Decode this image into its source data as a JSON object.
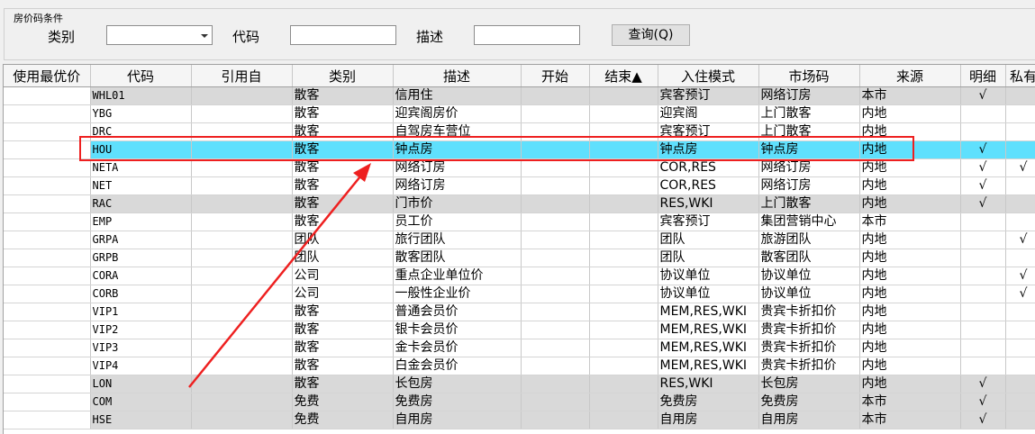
{
  "filter": {
    "title": "房价码条件",
    "category_label": "类别",
    "category_value": "",
    "code_label": "代码",
    "code_value": "",
    "desc_label": "描述",
    "desc_value": "",
    "query_button": "查询(Q)"
  },
  "table": {
    "columns": [
      "使用最优价",
      "代码",
      "引用自",
      "类别",
      "描述",
      "开始",
      "结束▲",
      "入住模式",
      "市场码",
      "来源",
      "明细",
      "私有"
    ],
    "rows": [
      {
        "best": "",
        "code": "WHL01",
        "ref": "",
        "cat": "散客",
        "desc": "信用住",
        "start": "",
        "end": "",
        "mode": "宾客预订",
        "market": "网络订房",
        "source": "本市",
        "detail": "√",
        "private": "",
        "style": "gray"
      },
      {
        "best": "",
        "code": "YBG",
        "ref": "",
        "cat": "散客",
        "desc": "迎宾阁房价",
        "start": "",
        "end": "",
        "mode": "迎宾阁",
        "market": "上门散客",
        "source": "内地",
        "detail": "",
        "private": "",
        "style": ""
      },
      {
        "best": "",
        "code": "DRC",
        "ref": "",
        "cat": "散客",
        "desc": "自驾房车营位",
        "start": "",
        "end": "",
        "mode": "宾客预订",
        "market": "上门散客",
        "source": "内地",
        "detail": "",
        "private": "",
        "style": ""
      },
      {
        "best": "",
        "code": "HOU",
        "ref": "",
        "cat": "散客",
        "desc": "钟点房",
        "start": "",
        "end": "",
        "mode": "钟点房",
        "market": "钟点房",
        "source": "内地",
        "detail": "√",
        "private": "",
        "style": "sel"
      },
      {
        "best": "",
        "code": "NETA",
        "ref": "",
        "cat": "散客",
        "desc": "网络订房",
        "start": "",
        "end": "",
        "mode": "COR,RES",
        "market": "网络订房",
        "source": "内地",
        "detail": "√",
        "private": "√",
        "style": ""
      },
      {
        "best": "",
        "code": "NET",
        "ref": "",
        "cat": "散客",
        "desc": "网络订房",
        "start": "",
        "end": "",
        "mode": "COR,RES",
        "market": "网络订房",
        "source": "内地",
        "detail": "√",
        "private": "",
        "style": ""
      },
      {
        "best": "",
        "code": "RAC",
        "ref": "",
        "cat": "散客",
        "desc": "门市价",
        "start": "",
        "end": "",
        "mode": "RES,WKI",
        "market": "上门散客",
        "source": "内地",
        "detail": "√",
        "private": "",
        "style": "gray"
      },
      {
        "best": "",
        "code": "EMP",
        "ref": "",
        "cat": "散客",
        "desc": "员工价",
        "start": "",
        "end": "",
        "mode": "宾客预订",
        "market": "集团营销中心",
        "source": "本市",
        "detail": "",
        "private": "",
        "style": ""
      },
      {
        "best": "",
        "code": "GRPA",
        "ref": "",
        "cat": "团队",
        "desc": "旅行团队",
        "start": "",
        "end": "",
        "mode": "团队",
        "market": "旅游团队",
        "source": "内地",
        "detail": "",
        "private": "√",
        "style": ""
      },
      {
        "best": "",
        "code": "GRPB",
        "ref": "",
        "cat": "团队",
        "desc": "散客团队",
        "start": "",
        "end": "",
        "mode": "团队",
        "market": "散客团队",
        "source": "内地",
        "detail": "",
        "private": "",
        "style": ""
      },
      {
        "best": "",
        "code": "CORA",
        "ref": "",
        "cat": "公司",
        "desc": "重点企业单位价",
        "start": "",
        "end": "",
        "mode": "协议单位",
        "market": "协议单位",
        "source": "内地",
        "detail": "",
        "private": "√",
        "style": ""
      },
      {
        "best": "",
        "code": "CORB",
        "ref": "",
        "cat": "公司",
        "desc": "一般性企业价",
        "start": "",
        "end": "",
        "mode": "协议单位",
        "market": "协议单位",
        "source": "内地",
        "detail": "",
        "private": "√",
        "style": ""
      },
      {
        "best": "",
        "code": "VIP1",
        "ref": "",
        "cat": "散客",
        "desc": "普通会员价",
        "start": "",
        "end": "",
        "mode": "MEM,RES,WKI",
        "market": "贵宾卡折扣价",
        "source": "内地",
        "detail": "",
        "private": "",
        "style": ""
      },
      {
        "best": "",
        "code": "VIP2",
        "ref": "",
        "cat": "散客",
        "desc": "银卡会员价",
        "start": "",
        "end": "",
        "mode": "MEM,RES,WKI",
        "market": "贵宾卡折扣价",
        "source": "内地",
        "detail": "",
        "private": "",
        "style": ""
      },
      {
        "best": "",
        "code": "VIP3",
        "ref": "",
        "cat": "散客",
        "desc": "金卡会员价",
        "start": "",
        "end": "",
        "mode": "MEM,RES,WKI",
        "market": "贵宾卡折扣价",
        "source": "内地",
        "detail": "",
        "private": "",
        "style": ""
      },
      {
        "best": "",
        "code": "VIP4",
        "ref": "",
        "cat": "散客",
        "desc": "白金会员价",
        "start": "",
        "end": "",
        "mode": "MEM,RES,WKI",
        "market": "贵宾卡折扣价",
        "source": "内地",
        "detail": "",
        "private": "",
        "style": ""
      },
      {
        "best": "",
        "code": "LON",
        "ref": "",
        "cat": "散客",
        "desc": "长包房",
        "start": "",
        "end": "",
        "mode": "RES,WKI",
        "market": "长包房",
        "source": "内地",
        "detail": "√",
        "private": "",
        "style": "gray"
      },
      {
        "best": "",
        "code": "COM",
        "ref": "",
        "cat": "免费",
        "desc": "免费房",
        "start": "",
        "end": "",
        "mode": "免费房",
        "market": "免费房",
        "source": "本市",
        "detail": "√",
        "private": "",
        "style": "gray"
      },
      {
        "best": "",
        "code": "HSE",
        "ref": "",
        "cat": "免费",
        "desc": "自用房",
        "start": "",
        "end": "",
        "mode": "自用房",
        "market": "自用房",
        "source": "本市",
        "detail": "√",
        "private": "",
        "style": "gray"
      }
    ]
  },
  "colors": {
    "selected_row": "#5fe0fd",
    "gray_row": "#d9d9d9",
    "annotation": "#ee2020"
  }
}
